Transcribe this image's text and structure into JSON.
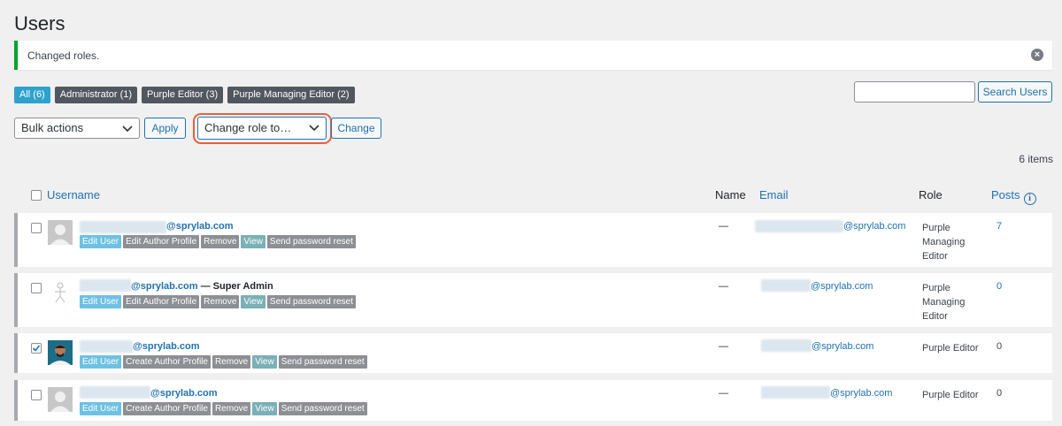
{
  "page": {
    "title": "Users"
  },
  "notice": {
    "text": "Changed roles.",
    "close_icon": "close-icon"
  },
  "filters": [
    {
      "label": "All (6)",
      "active": true
    },
    {
      "label": "Administrator (1)",
      "active": false
    },
    {
      "label": "Purple Editor (3)",
      "active": false
    },
    {
      "label": "Purple Managing Editor (2)",
      "active": false
    }
  ],
  "search": {
    "button": "Search Users",
    "value": ""
  },
  "toolbar": {
    "bulk_actions": "Bulk actions",
    "apply": "Apply",
    "change_role": "Change role to…",
    "change": "Change",
    "highlight_color": "#e8603c"
  },
  "items_count": "6 items",
  "table": {
    "headers": {
      "username": "Username",
      "name": "Name",
      "email": "Email",
      "role": "Role",
      "posts": "Posts"
    },
    "rows": [
      {
        "username": "@sprylab.com",
        "suffix": "",
        "name": "—",
        "email": "@sprylab.com",
        "role": "Purple Managing Editor",
        "posts": "7",
        "checked": false,
        "actions": [
          "Edit User",
          "Edit Author Profile",
          "Remove",
          "View",
          "Send password reset"
        ]
      },
      {
        "username": "@sprylab.com",
        "suffix": " — Super Admin",
        "name": "—",
        "email": "@sprylab.com",
        "role": "Purple Managing Editor",
        "posts": "0",
        "checked": false,
        "actions": [
          "Edit User",
          "Edit Author Profile",
          "Remove",
          "View",
          "Send password reset"
        ]
      },
      {
        "username": "@sprylab.com",
        "suffix": "",
        "name": "—",
        "email": "@sprylab.com",
        "role": "Purple Editor",
        "posts": "0",
        "checked": true,
        "actions": [
          "Edit User",
          "Create Author Profile",
          "Remove",
          "View",
          "Send password reset"
        ]
      },
      {
        "username": "@sprylab.com",
        "suffix": "",
        "name": "—",
        "email": "@sprylab.com",
        "role": "Purple Editor",
        "posts": "0",
        "checked": false,
        "actions": [
          "Edit User",
          "Create Author Profile",
          "Remove",
          "View",
          "Send password reset"
        ]
      }
    ]
  }
}
